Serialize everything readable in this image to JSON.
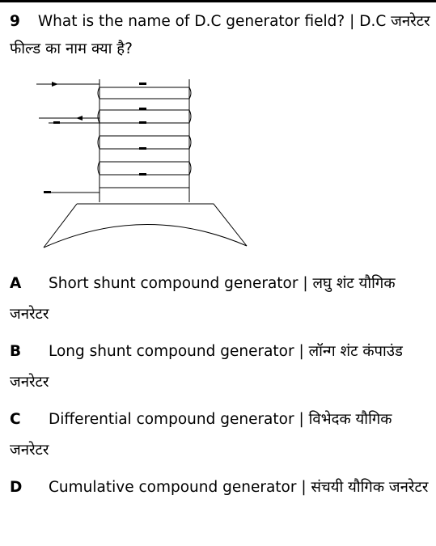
{
  "question": {
    "number": "9",
    "text": "What is the name of D.C generator field? | D.C जनरेटर फील्ड का नाम क्या है?"
  },
  "options": [
    {
      "letter": "A",
      "text": "Short shunt compound generator | लघु शंट यौगिक जनरेटर"
    },
    {
      "letter": "B",
      "text": "Long shunt compound generator | लॉन्ग शंट कंपाउंड जनरेटर"
    },
    {
      "letter": "C",
      "text": "Differential compound generator | विभेदक यौगिक जनरेटर"
    },
    {
      "letter": "D",
      "text": "Cumulative compound generator | संचयी यौगिक जनरेटर"
    }
  ]
}
